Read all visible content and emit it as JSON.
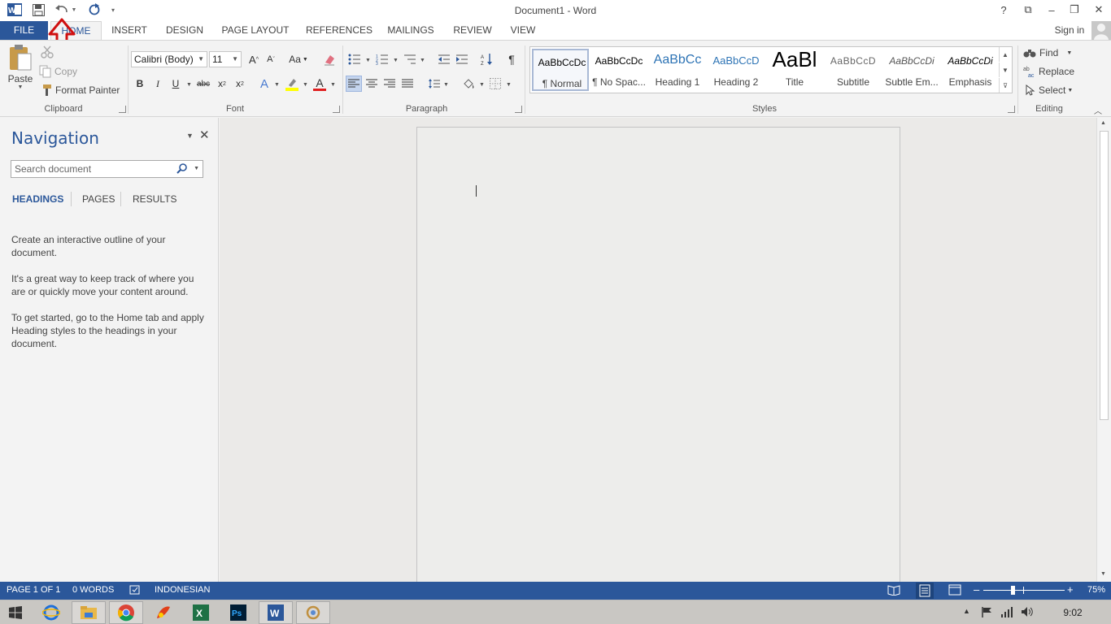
{
  "window": {
    "title": "Document1 - Word",
    "help_label": "?",
    "controls": {
      "minimize": "–",
      "restore": "❐",
      "close": "✕",
      "display_options": "⧉"
    }
  },
  "tabs": [
    {
      "label": "FILE"
    },
    {
      "label": "HOME"
    },
    {
      "label": "INSERT"
    },
    {
      "label": "DESIGN"
    },
    {
      "label": "PAGE LAYOUT"
    },
    {
      "label": "REFERENCES"
    },
    {
      "label": "MAILINGS"
    },
    {
      "label": "REVIEW"
    },
    {
      "label": "VIEW"
    }
  ],
  "account": {
    "sign_in": "Sign in"
  },
  "clipboard": {
    "paste": "Paste",
    "cut": "Cut",
    "copy": "Copy",
    "format_painter": "Format Painter",
    "group_label": "Clipboard"
  },
  "font": {
    "font_name": "Calibri (Body)",
    "font_size": "11",
    "group_label": "Font",
    "grow_label": "A",
    "shrink_label": "A",
    "case_label": "Aa",
    "bold": "B",
    "italic": "I",
    "underline": "U",
    "strike": "abc",
    "subscript": "x",
    "sup_base": "x",
    "text_effects": "A",
    "font_color": "A"
  },
  "paragraph": {
    "group_label": "Paragraph",
    "pilcrow": "¶"
  },
  "styles": {
    "group_label": "Styles",
    "items": [
      {
        "preview": "AaBbCcDc",
        "name": "¶ Normal"
      },
      {
        "preview": "AaBbCcDc",
        "name": "¶ No Spac..."
      },
      {
        "preview": "AaBbCc",
        "name": "Heading 1"
      },
      {
        "preview": "AaBbCcD",
        "name": "Heading 2"
      },
      {
        "preview": "AaBl",
        "name": "Title"
      },
      {
        "preview": "AaBbCcD",
        "name": "Subtitle"
      },
      {
        "preview": "AaBbCcDi",
        "name": "Subtle Em..."
      },
      {
        "preview": "AaBbCcDi",
        "name": "Emphasis"
      }
    ]
  },
  "editing": {
    "find": "Find",
    "replace": "Replace",
    "select": "Select",
    "group_label": "Editing"
  },
  "navigation": {
    "title": "Navigation",
    "search_placeholder": "Search document",
    "tabs": [
      "HEADINGS",
      "PAGES",
      "RESULTS"
    ],
    "paragraphs": [
      "Create an interactive outline of your document.",
      "It's a great way to keep track of where you are or quickly move your content around.",
      "To get started, go to the Home tab and apply Heading styles to the headings in your document."
    ]
  },
  "status": {
    "page": "PAGE 1 OF 1",
    "words": "0 WORDS",
    "language": "INDONESIAN",
    "zoom": "75%",
    "zoom_minus": "–",
    "zoom_plus": "+"
  },
  "taskbar": {
    "clock": "9:02"
  },
  "colors": {
    "accent": "#2b579a",
    "annotation_arrow": "#d01010"
  }
}
